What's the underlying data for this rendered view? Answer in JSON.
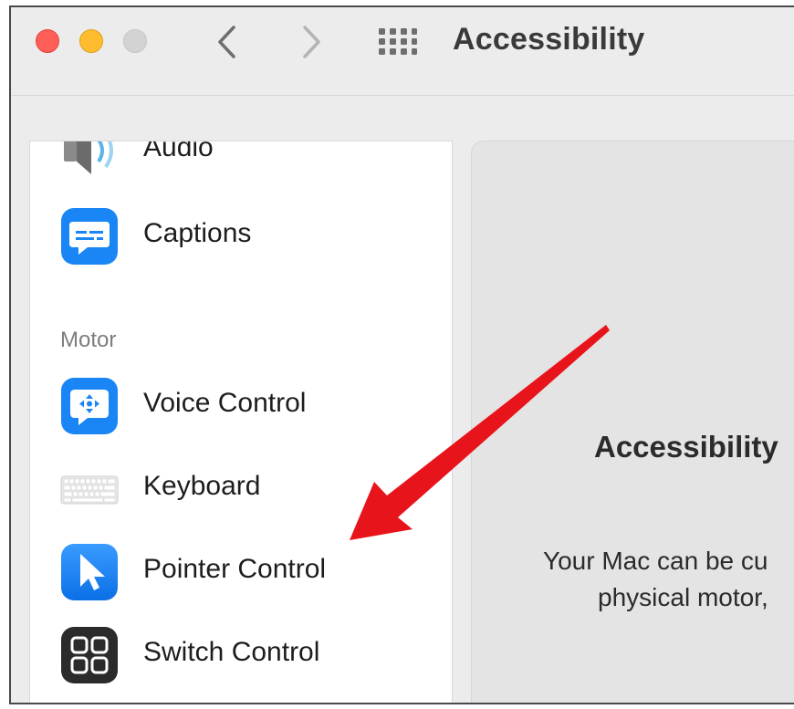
{
  "window": {
    "title": "Accessibility"
  },
  "sidebar": {
    "items_top": [
      {
        "label": "Audio",
        "icon": "speaker-icon"
      },
      {
        "label": "Captions",
        "icon": "captions-icon"
      }
    ],
    "section_motor": "Motor",
    "items_motor": [
      {
        "label": "Voice Control",
        "icon": "voice-control-icon"
      },
      {
        "label": "Keyboard",
        "icon": "keyboard-icon"
      },
      {
        "label": "Pointer Control",
        "icon": "pointer-icon"
      },
      {
        "label": "Switch Control",
        "icon": "switch-control-icon"
      }
    ]
  },
  "content": {
    "title": "Accessibility",
    "description_line1": "Your Mac can be cu",
    "description_line2": "physical motor,"
  },
  "annotation": {
    "arrow_color": "#e8141b",
    "points_to": "Pointer Control"
  },
  "colors": {
    "accent_blue": "#1a86f5",
    "close": "#ff5f57",
    "minimize": "#febc2e",
    "zoom_disabled": "#d3d3d3"
  }
}
